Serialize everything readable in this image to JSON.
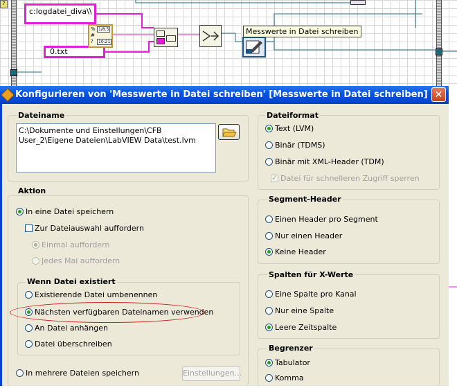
{
  "diagram": {
    "path_constant": "c:logdatei_diva\\\\",
    "extension_constant": "0.txt",
    "tooltip": "Messwerte in Datei schreiben",
    "node_small_labels": [
      "1/8.5",
      "10:21"
    ]
  },
  "dialog": {
    "title": "Konfigurieren von 'Messwerte in Datei schreiben' [Messwerte in Datei schreiben]",
    "close_label": "✕",
    "dateiname": {
      "label": "Dateiname",
      "path": "C:\\Dokumente und Einstellungen\\CFB User_2\\Eigene Dateien\\LabVIEW Data\\test.lvm",
      "browse_icon": "folder-open-icon"
    },
    "aktion": {
      "label": "Aktion",
      "single_file": "In eine Datei speichern",
      "prompt_checkbox": "Zur Dateiauswahl auffordern",
      "ask_once": "Einmal auffordern",
      "ask_always": "Jedes Mal auffordern",
      "exists_group": {
        "label": "Wenn Datei existiert",
        "rename": "Existierende Datei umbenennen",
        "next_name": "Nächsten verfügbaren Dateinamen verwenden",
        "append": "An Datei anhängen",
        "overwrite": "Datei überschreiben"
      },
      "multiple_files": "In mehrere Dateien speichern",
      "settings_button": "Einstellungen..."
    },
    "dateiformat": {
      "label": "Dateiformat",
      "text": "Text (LVM)",
      "binary": "Binär (TDMS)",
      "binary_xml": "Binär mit XML-Header (TDM)",
      "lock": "Datei für schnelleren Zugriff sperren"
    },
    "segment_header": {
      "label": "Segment-Header",
      "per_segment": "Einen Header pro Segment",
      "one_header": "Nur einen Header",
      "none": "Keine Header"
    },
    "x_columns": {
      "label": "Spalten für X-Werte",
      "per_channel": "Eine Spalte pro Kanal",
      "one_column": "Nur eine Spalte",
      "empty": "Leere Zeitspalte"
    },
    "delimiter": {
      "label": "Begrenzer",
      "tab": "Tabulator",
      "comma": "Komma"
    }
  },
  "colors": {
    "titlebar": "#0454e0",
    "path_wire": "#e31ed6",
    "highlight": "#d02020",
    "dialog_bg": "#ece9d8"
  }
}
